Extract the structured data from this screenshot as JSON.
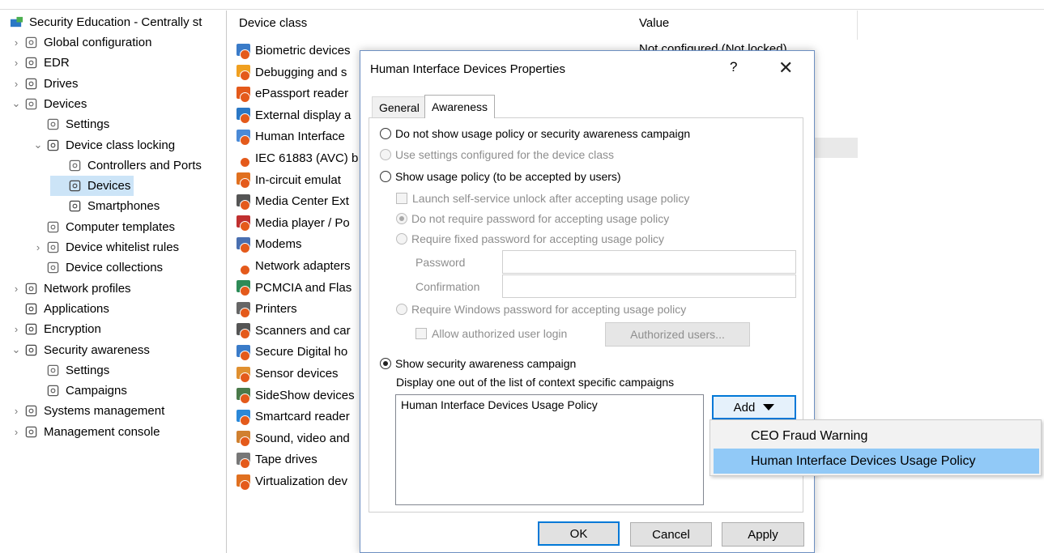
{
  "tree": {
    "root": "Security Education - Centrally st",
    "items": [
      {
        "label": "Global configuration",
        "icon": "gear-icon",
        "arrow": "›"
      },
      {
        "label": "EDR",
        "icon": "tools-icon",
        "arrow": "›"
      },
      {
        "label": "Drives",
        "icon": "drive-icon",
        "arrow": "›"
      },
      {
        "label": "Devices",
        "icon": "devices-icon",
        "arrow": "⌄"
      },
      {
        "label": "Settings",
        "icon": "gear-icon",
        "arrow": ""
      },
      {
        "label": "Device class locking",
        "icon": "lock-icon",
        "arrow": "⌄"
      },
      {
        "label": "Controllers and Ports",
        "icon": "port-icon",
        "arrow": ""
      },
      {
        "label": "Devices",
        "icon": "device-icon",
        "arrow": ""
      },
      {
        "label": "Smartphones",
        "icon": "phone-icon",
        "arrow": ""
      },
      {
        "label": "Computer templates",
        "icon": "template-icon",
        "arrow": ""
      },
      {
        "label": "Device whitelist rules",
        "icon": "devices-icon",
        "arrow": "›"
      },
      {
        "label": "Device collections",
        "icon": "folder-icon",
        "arrow": ""
      },
      {
        "label": "Network profiles",
        "icon": "network-icon",
        "arrow": "›"
      },
      {
        "label": "Applications",
        "icon": "app-icon",
        "arrow": ""
      },
      {
        "label": "Encryption",
        "icon": "lock-icon",
        "arrow": "›"
      },
      {
        "label": "Security awareness",
        "icon": "awareness-icon",
        "arrow": "⌄"
      },
      {
        "label": "Settings",
        "icon": "gear-icon",
        "arrow": ""
      },
      {
        "label": "Campaigns",
        "icon": "campaign-icon",
        "arrow": ""
      },
      {
        "label": "Systems management",
        "icon": "systems-icon",
        "arrow": "›"
      },
      {
        "label": "Management console",
        "icon": "console-icon",
        "arrow": "›"
      }
    ]
  },
  "list": {
    "col_device": "Device class",
    "col_value": "Value",
    "first_value": "Not configured (Not locked)",
    "rows": [
      "Biometric devices",
      "Debugging and s",
      "ePassport reader",
      "External display a",
      "Human Interface",
      "IEC 61883 (AVC) b",
      "In-circuit emulat",
      "Media Center Ext",
      "Media player / Po",
      "Modems",
      "Network adapters",
      "PCMCIA and Flas",
      "Printers",
      "Scanners and car",
      "Secure Digital ho",
      "Sensor devices",
      "SideShow devices",
      "Smartcard reader",
      "Sound, video and",
      "Tape drives",
      "Virtualization dev"
    ]
  },
  "dialog": {
    "title": "Human Interface Devices Properties",
    "help": "?",
    "close": "✕",
    "tab_general": "General",
    "tab_awareness": "Awareness",
    "opt_no_policy": "Do not show usage policy or security awareness campaign",
    "opt_use_class": "Use settings configured for the device class",
    "opt_show_policy": "Show usage policy (to be accepted by users)",
    "chk_launch": "Launch self-service unlock after accepting usage policy",
    "opt_no_password": "Do not require password for accepting usage policy",
    "opt_fixed_password": "Require fixed password for accepting usage policy",
    "label_password": "Password",
    "label_confirmation": "Confirmation",
    "opt_windows_password": "Require Windows password for accepting usage policy",
    "chk_allow_login": "Allow authorized user login",
    "btn_authorized": "Authorized users...",
    "opt_campaign": "Show security awareness campaign",
    "campaign_desc": "Display one out of the list of context specific campaigns",
    "campaign_items": [
      "Human Interface Devices Usage Policy"
    ],
    "btn_add": "Add",
    "btn_ok": "OK",
    "btn_cancel": "Cancel",
    "btn_apply": "Apply"
  },
  "menu": {
    "items": [
      "CEO Fraud Warning",
      "Human Interface Devices Usage Policy"
    ],
    "highlight_color": "#91c9f7"
  }
}
